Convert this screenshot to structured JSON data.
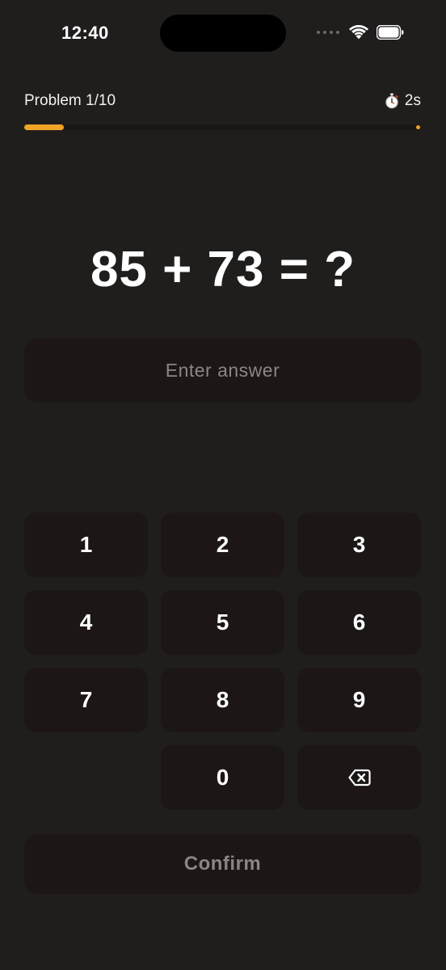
{
  "status_bar": {
    "time": "12:40"
  },
  "header": {
    "problem_label": "Problem 1/10",
    "timer_icon": "stopwatch-icon",
    "timer_value": "2s"
  },
  "progress": {
    "fraction": 0.1,
    "color": "#f0a324"
  },
  "problem": {
    "expression": "85 + 73 = ?"
  },
  "answer": {
    "value": "",
    "placeholder": "Enter answer"
  },
  "keypad": {
    "keys": [
      "1",
      "2",
      "3",
      "4",
      "5",
      "6",
      "7",
      "8",
      "9",
      "0"
    ],
    "backspace_icon": "backspace-icon"
  },
  "confirm": {
    "label": "Confirm"
  },
  "colors": {
    "background": "#201e1d",
    "surface": "#1c1616",
    "accent": "#f0a324",
    "muted_text": "#8b8685"
  }
}
